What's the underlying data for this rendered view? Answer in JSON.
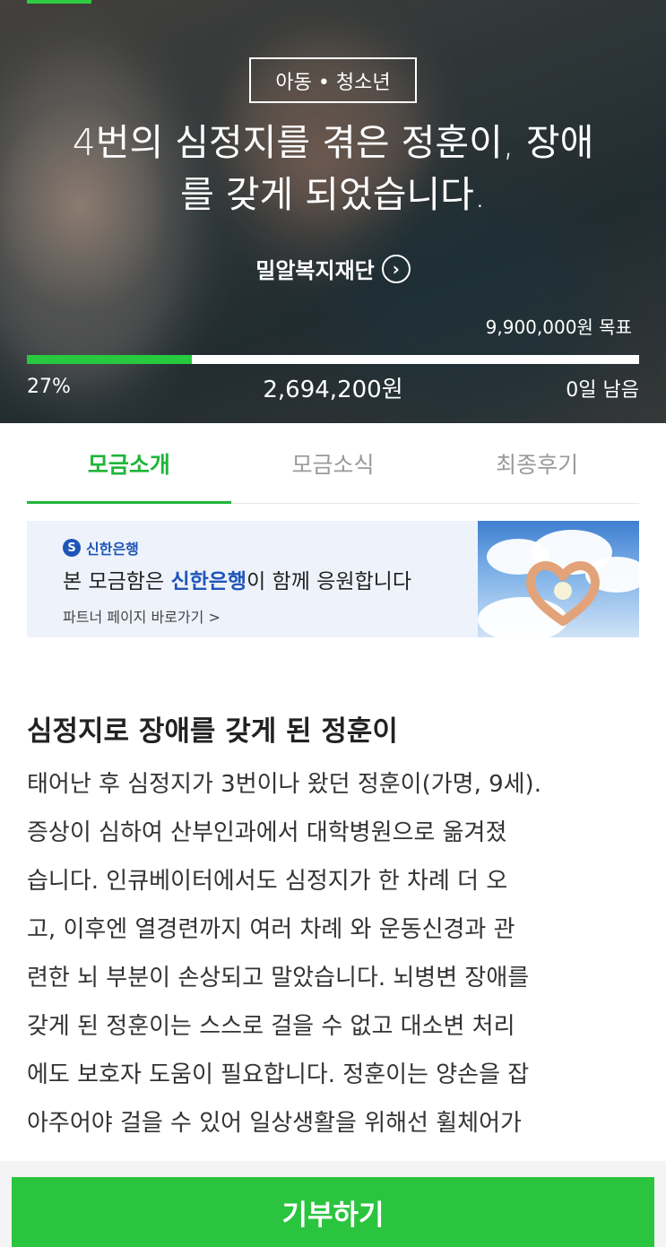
{
  "hero": {
    "category": "아동 • 청소년",
    "title": "4번의 심정지를 겪은 정훈이, 장애를 갖게 되었습니다.",
    "title_line1": "4번의 심정지를 겪은 정훈이, 장애",
    "title_line2": "를 갖게 되었습니다.",
    "organization": "밀알복지재단",
    "goal": "9,900,000원 목표",
    "progress_percent_label": "27%",
    "progress_fraction": 0.27,
    "raised": "2,694,200원",
    "days_left": "0일 남음"
  },
  "tabs": [
    {
      "label": "모금소개",
      "active": true
    },
    {
      "label": "모금소식",
      "active": false
    },
    {
      "label": "최종후기",
      "active": false
    }
  ],
  "banner": {
    "bank_name": "신한은행",
    "text_prefix": "본 모금함은 ",
    "text_highlight": "신한은행",
    "text_suffix": "이 함께 응원합니다",
    "link": "파트너 페이지 바로가기 >"
  },
  "content": {
    "section_title": "심정지로 장애를 갖게 된 정훈이",
    "lines": [
      "태어난 후 심정지가 3번이나 왔던 정훈이(가명, 9세).",
      "증상이 심하여 산부인과에서 대학병원으로 옮겨졌",
      "습니다. 인큐베이터에서도 심정지가 한 차례 더 오",
      "고, 이후엔 열경련까지 여러 차례 와 운동신경과 관",
      "련한 뇌 부분이 손상되고 말았습니다. 뇌병변 장애를",
      "갖게 된 정훈이는 스스로 걸을 수 없고 대소변 처리",
      "에도 보호자 도움이 필요합니다. 정훈이는 양손을 잡",
      "아주어야 걸을 수 있어 일상생활을 위해선 휠체어가"
    ]
  },
  "donate_button": "기부하기",
  "colors": {
    "accent_green": "#2bc43f",
    "bank_blue": "#1f55b8"
  }
}
